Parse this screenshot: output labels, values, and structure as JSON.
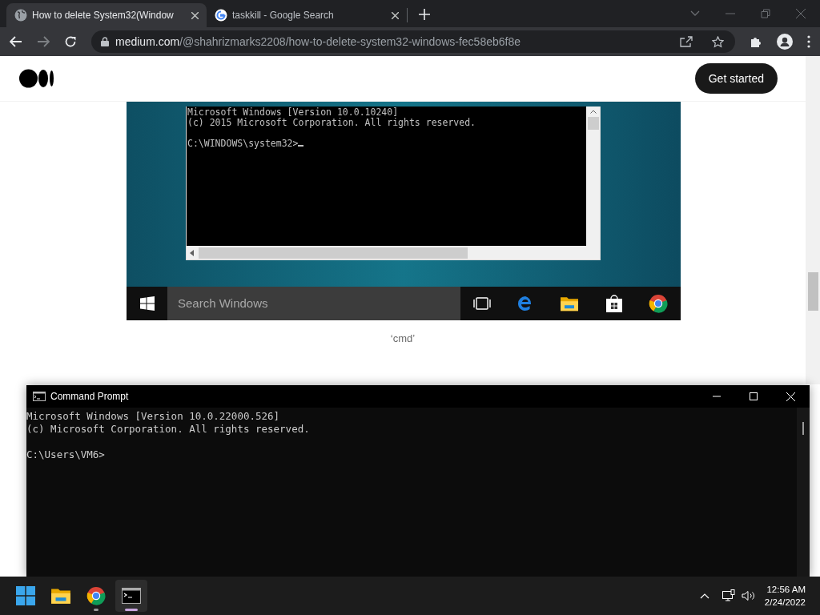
{
  "browser": {
    "tabs": [
      {
        "title": "How to delete System32(Window",
        "selected": true,
        "kind": "globe"
      },
      {
        "title": "taskkill - Google Search",
        "selected": false,
        "kind": "google"
      }
    ],
    "url_host": "medium.com",
    "url_path": "/@shahrizmarks2208/how-to-delete-system32-windows-fec58eb6f8e"
  },
  "page": {
    "header_button": "Get started",
    "figure": {
      "console_lines": [
        "Microsoft Windows [Version 10.0.10240]",
        "(c) 2015 Microsoft Corporation. All rights reserved."
      ],
      "prompt": "C:\\WINDOWS\\system32>",
      "search_placeholder": "Search Windows"
    },
    "caption": "‘cmd’"
  },
  "cmd_window": {
    "title": "Command Prompt",
    "lines": [
      "Microsoft Windows [Version 10.0.22000.526]",
      "(c) Microsoft Corporation. All rights reserved."
    ],
    "prompt": "C:\\Users\\VM6>"
  },
  "taskbar": {
    "apps": [
      {
        "kind": "explorer",
        "running": false,
        "active": false
      },
      {
        "kind": "chrome",
        "running": true,
        "active": false
      },
      {
        "kind": "terminal",
        "running": true,
        "active": true
      }
    ],
    "time": "12:56 AM",
    "date": "2/24/2022"
  }
}
